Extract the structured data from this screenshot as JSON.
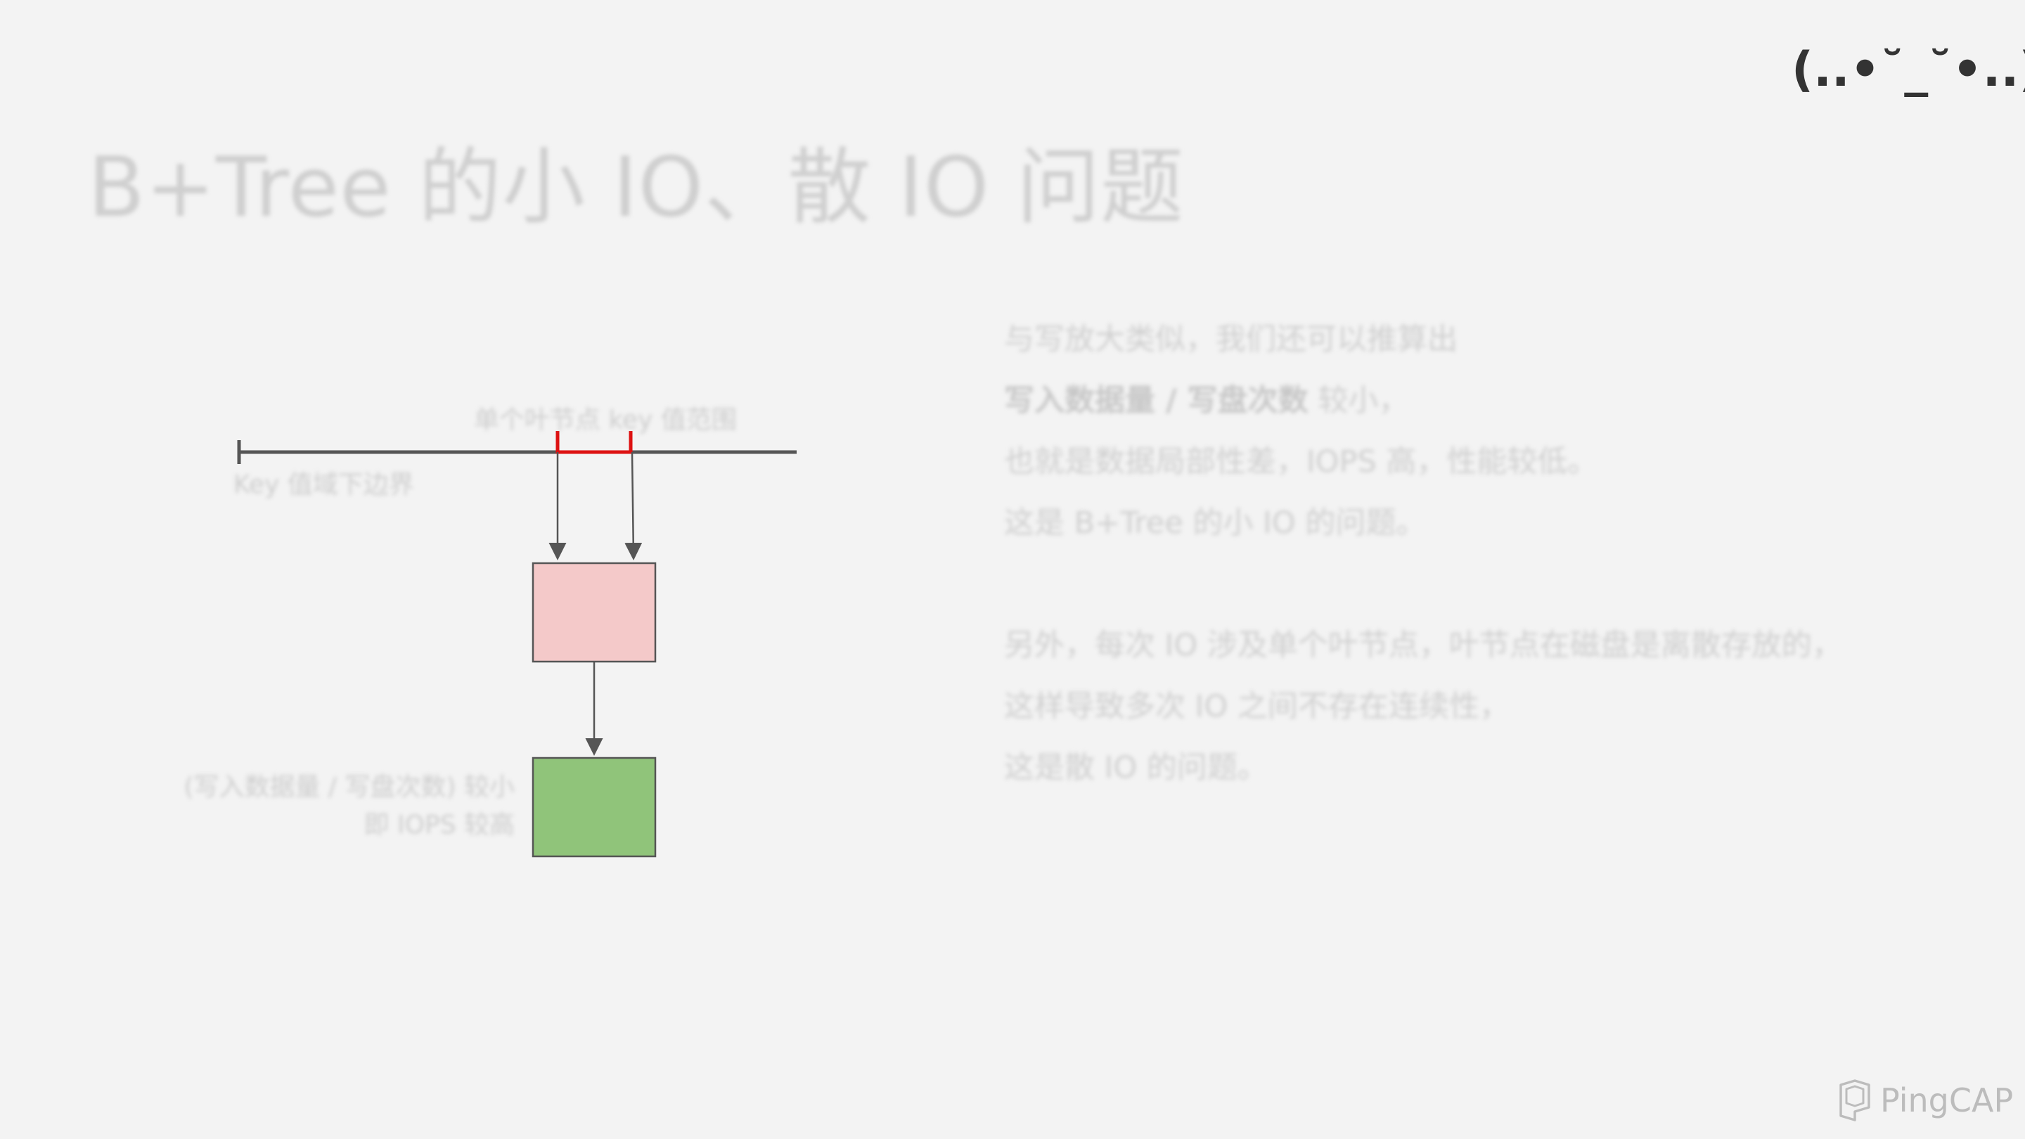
{
  "slide": {
    "title": "B+Tree 的小 IO、散 IO 问题",
    "emoticon": "(..•˘_˘•..)"
  },
  "diagram": {
    "leaf_range_label": "单个叶节点 key 值范围",
    "key_lower_bound_label": "Key 值域下边界",
    "bottom_label_line1": "(写入数据量 / 写盘次数) 较小",
    "bottom_label_line2": "即 IOPS 较高",
    "colors": {
      "axis": "#555555",
      "range_bracket": "#dd1111",
      "arrow": "#555555",
      "pink_box": "#f4c9c9",
      "green_box": "#90c47a",
      "box_border": "#555555"
    }
  },
  "text": {
    "p1_line1": "与写放大类似，我们还可以推算出",
    "p1_line2_bold": "写入数据量 / 写盘次数",
    "p1_line2_rest": " 较小，",
    "p1_line3": "也就是数据局部性差，IOPS 高，性能较低。",
    "p1_line4": "这是 B+Tree 的小 IO 的问题。",
    "p2_line1": "另外，每次 IO 涉及单个叶节点，叶节点在磁盘是离散存放的，",
    "p2_line2": "这样导致多次 IO 之间不存在连续性，",
    "p2_line3": "这是散 IO 的问题。"
  },
  "logo": {
    "text": "PingCAP",
    "icon": "pingcap-logo-icon"
  }
}
